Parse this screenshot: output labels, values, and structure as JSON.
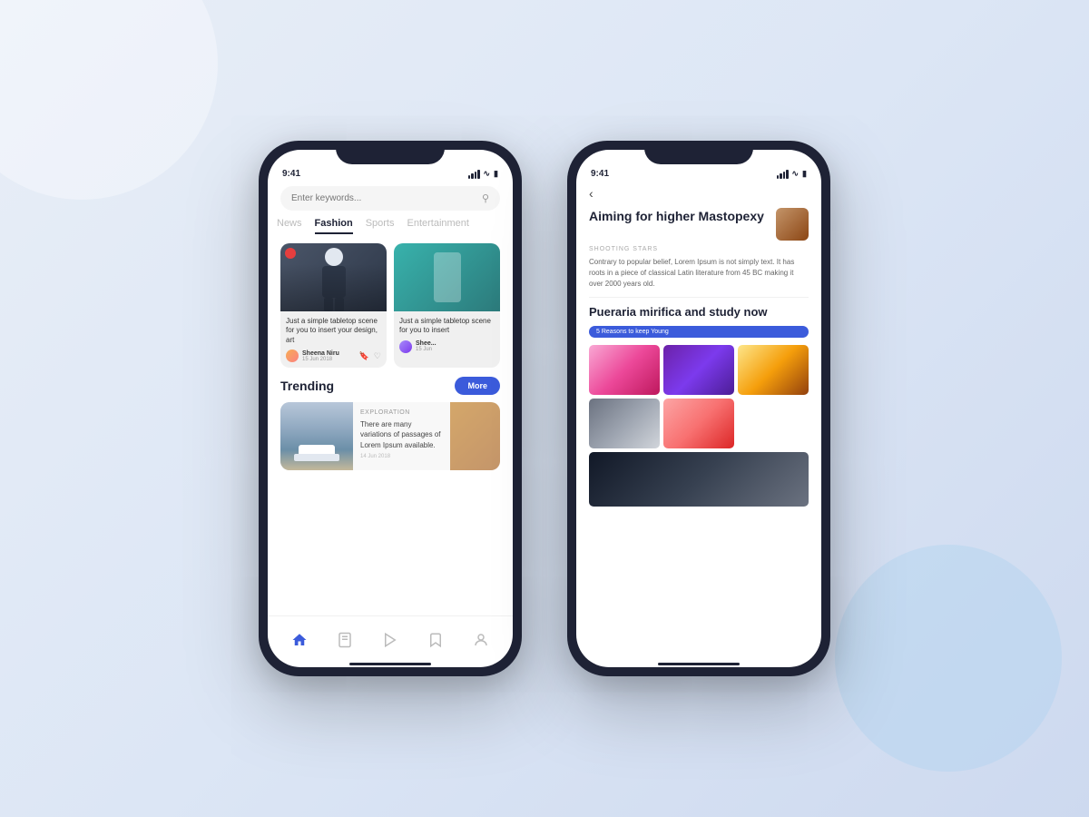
{
  "background": {
    "color": "#e8eef7"
  },
  "phone1": {
    "status_bar": {
      "time": "9:41"
    },
    "search": {
      "placeholder": "Enter keywords..."
    },
    "tabs": [
      {
        "label": "News",
        "active": false
      },
      {
        "label": "Fashion",
        "active": true
      },
      {
        "label": "Sports",
        "active": false
      },
      {
        "label": "Entertainment",
        "active": false
      }
    ],
    "cards": [
      {
        "title": "Just a simple tabletop scene for you to insert your design, art",
        "author_name": "Sheena Niru",
        "author_date": "15 Jun 2018"
      },
      {
        "title": "Just a simple tabletop scene for you to insert",
        "author_name": "Shee...",
        "author_date": "15 Jun"
      }
    ],
    "trending": {
      "title": "Trending",
      "more_btn": "More",
      "item": {
        "category": "EXPLORATION",
        "description": "There are many variations of passages of Lorem Ipsum available.",
        "date": "14 Jun 2018"
      }
    },
    "bottom_nav": [
      {
        "label": "home",
        "icon": "⌂",
        "active": true
      },
      {
        "label": "bookmarks",
        "icon": "☰",
        "active": false
      },
      {
        "label": "play",
        "icon": "▷",
        "active": false
      },
      {
        "label": "saved",
        "icon": "⊹",
        "active": false
      },
      {
        "label": "profile",
        "icon": "○",
        "active": false
      }
    ]
  },
  "phone2": {
    "status_bar": {
      "time": "9:41"
    },
    "back_label": "‹",
    "article1": {
      "title": "Aiming for higher Mastopexy",
      "category": "SHOOTING STARS",
      "body": "Contrary to popular belief, Lorem Ipsum is not simply text. It has roots in a piece of classical Latin literature from 45 BC making it over 2000 years old."
    },
    "article2": {
      "title": "Pueraria mirifica and study now",
      "tag": "5 Reasons to keep Young"
    }
  }
}
